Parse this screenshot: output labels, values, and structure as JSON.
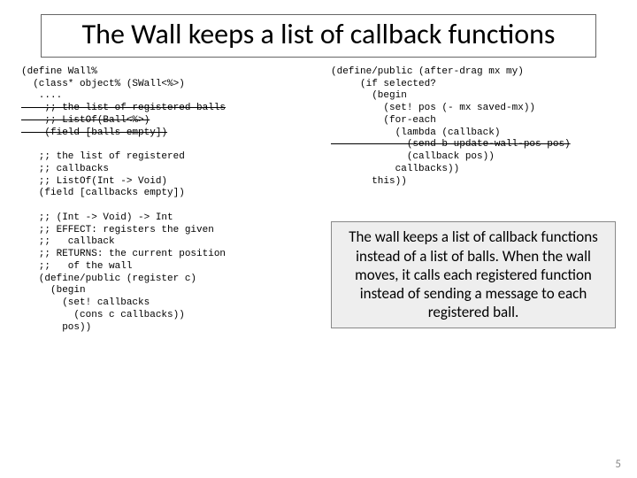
{
  "title": "The Wall keeps a list of callback functions",
  "code_left_top": "(define Wall%\n  (class* object% (SWall<%>)\n   ....\n",
  "code_left_strike": "    ;; the list of registered balls\n    ;; ListOf(Ball<%>)\n    (field [balls empty])",
  "code_left_mid": "\n\n   ;; the list of registered\n   ;; callbacks\n   ;; ListOf(Int -> Void)\n   (field [callbacks empty])\n\n   ;; (Int -> Void) -> Int\n   ;; EFFECT: registers the given\n   ;;   callback\n   ;; RETURNS: the current position\n   ;;   of the wall\n   (define/public (register c)\n     (begin\n       (set! callbacks\n         (cons c callbacks))\n       pos))",
  "code_right_top": "(define/public (after-drag mx my)\n     (if selected?\n       (begin\n         (set! pos (- mx saved-mx))\n         (for-each\n           (lambda (callback)",
  "code_right_strike": "             (send b update-wall-pos pos)",
  "code_right_bottom": "             (callback pos))\n           callbacks))\n       this))",
  "explain": "The wall keeps a list of callback functions instead of a list of balls.  When the wall moves, it calls each registered function instead of sending a message to each registered ball.",
  "pagenum": "5"
}
